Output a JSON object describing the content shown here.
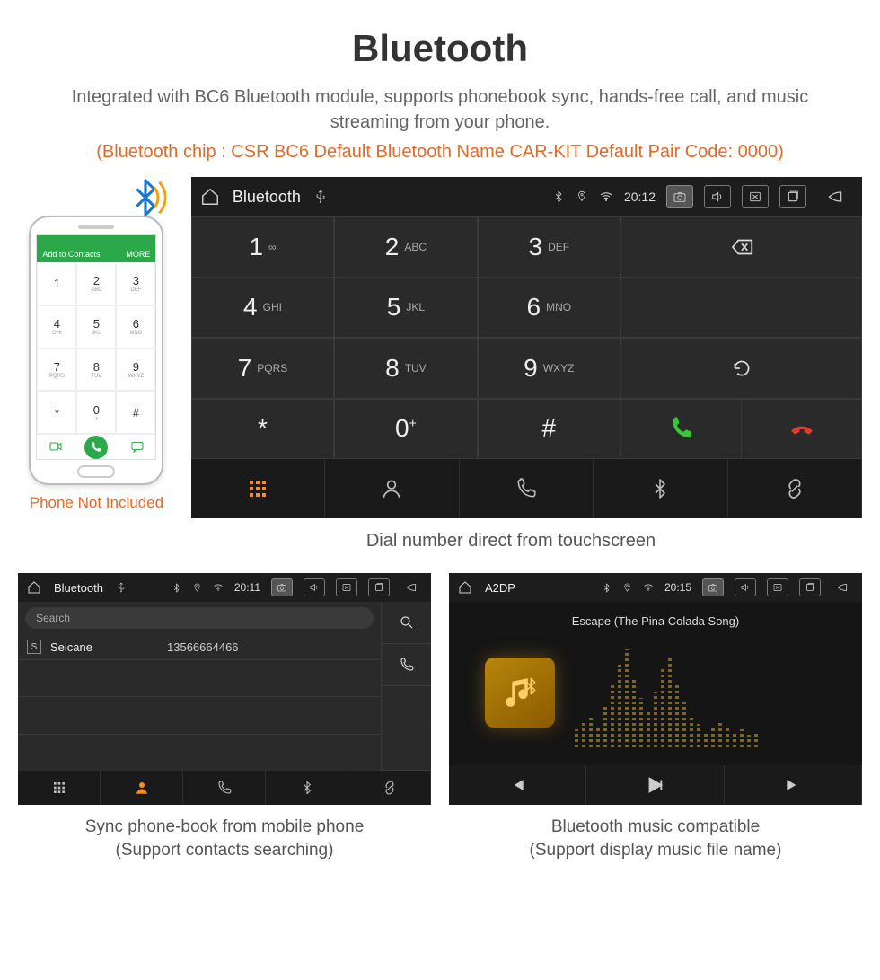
{
  "page": {
    "title": "Bluetooth",
    "subtitle": "Integrated with BC6 Bluetooth module, supports phonebook sync, hands-free call, and music streaming from your phone.",
    "specline": "(Bluetooth chip : CSR BC6     Default Bluetooth Name CAR-KIT     Default Pair Code: 0000)"
  },
  "phone_mock": {
    "addbar_left": "Add to Contacts",
    "addbar_right": "MORE",
    "keys": [
      {
        "n": "1",
        "l": ""
      },
      {
        "n": "2",
        "l": "ABC"
      },
      {
        "n": "3",
        "l": "DEF"
      },
      {
        "n": "4",
        "l": "GHI"
      },
      {
        "n": "5",
        "l": "JKL"
      },
      {
        "n": "6",
        "l": "MNO"
      },
      {
        "n": "7",
        "l": "PQRS"
      },
      {
        "n": "8",
        "l": "TUV"
      },
      {
        "n": "9",
        "l": "WXYZ"
      },
      {
        "n": "*",
        "l": ""
      },
      {
        "n": "0",
        "l": "+"
      },
      {
        "n": "#",
        "l": ""
      }
    ],
    "caption": "Phone Not Included"
  },
  "dial": {
    "status": {
      "title": "Bluetooth",
      "time": "20:12"
    },
    "keys": [
      {
        "n": "1",
        "l": "∞"
      },
      {
        "n": "2",
        "l": "ABC"
      },
      {
        "n": "3",
        "l": "DEF"
      },
      {
        "n": "4",
        "l": "GHI"
      },
      {
        "n": "5",
        "l": "JKL"
      },
      {
        "n": "6",
        "l": "MNO"
      },
      {
        "n": "7",
        "l": "PQRS"
      },
      {
        "n": "8",
        "l": "TUV"
      },
      {
        "n": "9",
        "l": "WXYZ"
      },
      {
        "n": "*",
        "l": ""
      },
      {
        "n": "0",
        "l": "+",
        "sup": true
      },
      {
        "n": "#",
        "l": ""
      }
    ],
    "caption": "Dial number direct from touchscreen"
  },
  "phonebook": {
    "status": {
      "title": "Bluetooth",
      "time": "20:11"
    },
    "search_placeholder": "Search",
    "contact": {
      "initial": "S",
      "name": "Seicane",
      "number": "13566664466"
    },
    "caption_line1": "Sync phone-book from mobile phone",
    "caption_line2": "(Support contacts searching)"
  },
  "a2dp": {
    "status": {
      "title": "A2DP",
      "time": "20:15"
    },
    "song": "Escape (The Pina Colada Song)",
    "caption_line1": "Bluetooth music compatible",
    "caption_line2": "(Support display music file name)"
  }
}
